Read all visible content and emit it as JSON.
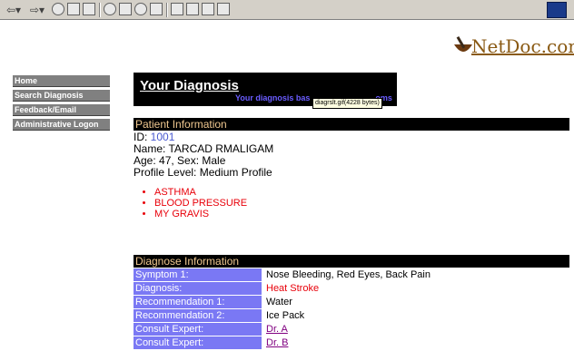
{
  "logo": {
    "text": "NetDoc.com"
  },
  "nav": {
    "items": [
      "Home",
      "Search Diagnosis",
      "Feedback/Email",
      "Administrative Logon"
    ]
  },
  "banner": {
    "title": "Your Diagnosis",
    "subtitle": "Your diagnosis bas",
    "subtitle_tail": "oms",
    "tooltip": "diagrslt.gif(4228 bytes)"
  },
  "patient": {
    "header": "Patient Information",
    "id_label": "ID: ",
    "id_value": "1001",
    "name_line": "Name: TARCAD RMALIGAM",
    "age_line": "Age: 47, Sex: Male",
    "profile_line": "Profile Level: Medium Profile",
    "conditions": [
      "ASTHMA",
      "BLOOD PRESSURE",
      "MY GRAVIS"
    ]
  },
  "diagnose": {
    "header": "Diagnose Information",
    "rows": [
      {
        "label": "Symptom 1:",
        "value": "Nose Bleeding, Red Eyes, Back Pain"
      },
      {
        "label": "Diagnosis:",
        "value": "Heat Stroke"
      },
      {
        "label": "Recommendation 1:",
        "value": "Water"
      },
      {
        "label": "Recommendation 2:",
        "value": "Ice Pack"
      },
      {
        "label": "Consult Expert:",
        "value": "Dr. A"
      },
      {
        "label": "Consult Expert:",
        "value": "Dr. B"
      }
    ]
  },
  "colors": {
    "nav_bg": "#808080",
    "label_bg": "#7a78f4",
    "condition_red": "#e8000a",
    "link_purple": "#800080",
    "header_text": "#f0c890"
  },
  "toolbar": {
    "icons": [
      "back-icon",
      "forward-icon",
      "stop-icon",
      "refresh-icon",
      "home-icon",
      "search-icon",
      "favorites-icon",
      "history-icon",
      "channels-icon",
      "fullscreen-icon",
      "mail-icon",
      "print-icon",
      "edit-icon",
      "windows-logo-icon"
    ]
  }
}
